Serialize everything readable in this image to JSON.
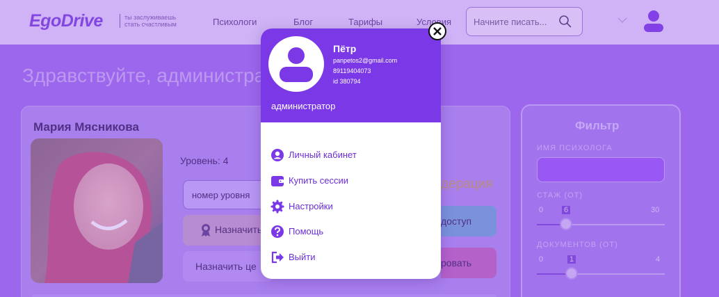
{
  "header": {
    "logo": "EgoDrive",
    "tagline": "ты заслуживаешь стать счастливым",
    "nav": [
      "Психологи",
      "Блог",
      "Тарифы",
      "Условия"
    ],
    "search_placeholder": "Начните писать..."
  },
  "greeting": "Здравствуйте, администратор",
  "card": {
    "name": "Мария Мясникова",
    "level_label": "Уровень: 4",
    "level_input_placeholder": "номер уровня",
    "assign_level_label": "Назначить",
    "assign_center_label": "Назначить це",
    "moderation_label": "дерация",
    "access_label": "доступ",
    "block_label": "ровать"
  },
  "filter": {
    "title": "Фильтр",
    "psych_name_label": "ИМЯ ПСИХОЛОГА",
    "experience_label": "СТАЖ (ОТ)",
    "experience_min": "0",
    "experience_value": "6",
    "experience_max": "30",
    "documents_label": "ДОКУМЕНТОВ (ОТ)",
    "documents_min": "0",
    "documents_value": "1",
    "documents_max": "4"
  },
  "popup": {
    "name": "Пётр",
    "email": "panpetos2@gmail.com",
    "phone": "89119404073",
    "id": "id 380794",
    "role": "администратор",
    "menu": [
      {
        "label": "Личный кабинет",
        "icon": "user-circle-icon"
      },
      {
        "label": "Купить сессии",
        "icon": "wallet-icon"
      },
      {
        "label": "Настройки",
        "icon": "gear-icon"
      },
      {
        "label": "Помощь",
        "icon": "question-icon"
      },
      {
        "label": "Выйти",
        "icon": "logout-icon"
      }
    ]
  },
  "colors": {
    "accent": "#7b38e6",
    "header_bg": "#e6d6fc",
    "page_bg": "#a06cf0",
    "menu_text": "#6b2ed6"
  }
}
